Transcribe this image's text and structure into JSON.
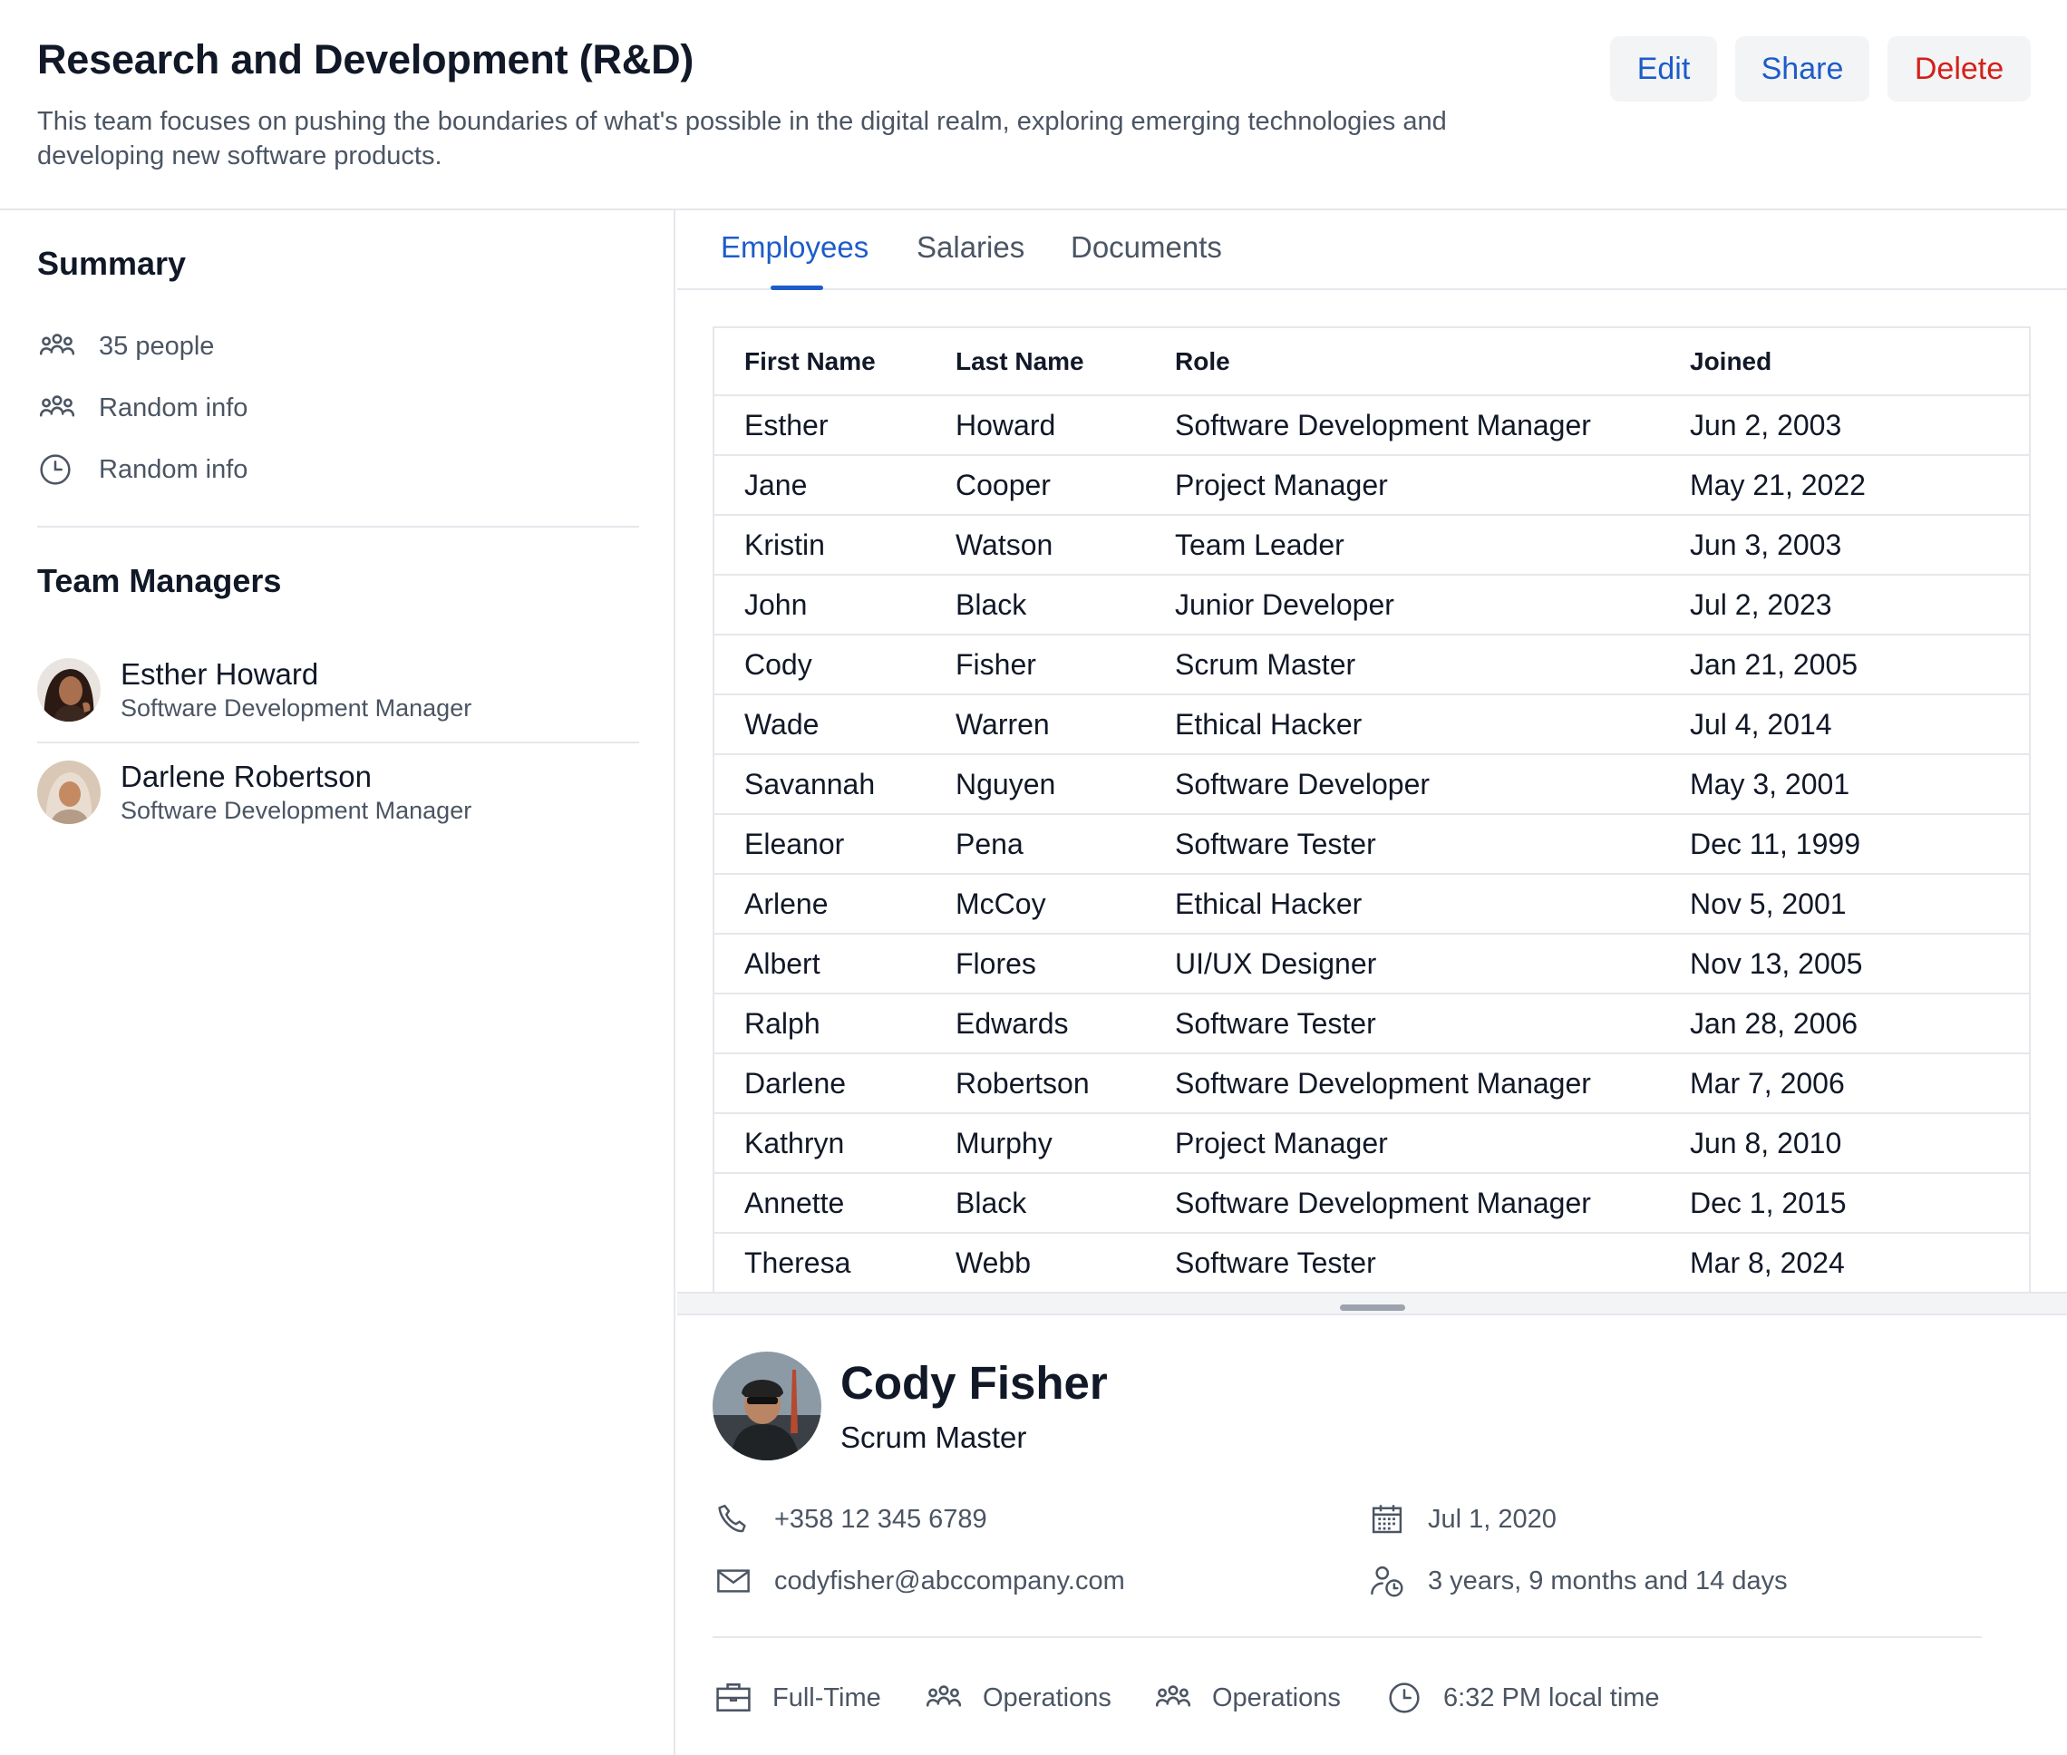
{
  "header": {
    "title": "Research and Development (R&D)",
    "description": "This team focuses on pushing the boundaries of what's possible in the digital realm, exploring emerging technologies and developing new software products.",
    "buttons": {
      "edit": "Edit",
      "share": "Share",
      "delete": "Delete"
    }
  },
  "sidebar": {
    "summary_title": "Summary",
    "summary_items": [
      {
        "icon": "people-group-icon",
        "label": "35 people"
      },
      {
        "icon": "people-group-icon",
        "label": "Random info"
      },
      {
        "icon": "clock-icon",
        "label": "Random info"
      }
    ],
    "managers_title": "Team Managers",
    "managers": [
      {
        "name": "Esther Howard",
        "role": "Software Development Manager"
      },
      {
        "name": "Darlene Robertson",
        "role": "Software Development Manager"
      }
    ]
  },
  "tabs": [
    "Employees",
    "Salaries",
    "Documents"
  ],
  "active_tab": "Employees",
  "table": {
    "headers": [
      "First Name",
      "Last Name",
      "Role",
      "Joined"
    ],
    "rows": [
      [
        "Esther",
        "Howard",
        "Software Development Manager",
        "Jun 2, 2003"
      ],
      [
        "Jane",
        "Cooper",
        "Project Manager",
        "May 21, 2022"
      ],
      [
        "Kristin",
        "Watson",
        "Team Leader",
        "Jun 3, 2003"
      ],
      [
        "John",
        "Black",
        "Junior Developer",
        "Jul 2, 2023"
      ],
      [
        "Cody",
        "Fisher",
        "Scrum Master",
        "Jan 21, 2005"
      ],
      [
        "Wade",
        "Warren",
        "Ethical Hacker",
        "Jul 4, 2014"
      ],
      [
        "Savannah",
        "Nguyen",
        "Software Developer",
        "May 3, 2001"
      ],
      [
        "Eleanor",
        "Pena",
        "Software Tester",
        "Dec 11, 1999"
      ],
      [
        "Arlene",
        "McCoy",
        "Ethical Hacker",
        "Nov 5, 2001"
      ],
      [
        "Albert",
        "Flores",
        "UI/UX Designer",
        "Nov 13, 2005"
      ],
      [
        "Ralph",
        "Edwards",
        "Software Tester",
        "Jan 28, 2006"
      ],
      [
        "Darlene",
        "Robertson",
        "Software Development Manager",
        "Mar 7, 2006"
      ],
      [
        "Kathryn",
        "Murphy",
        "Project Manager",
        "Jun 8, 2010"
      ],
      [
        "Annette",
        "Black",
        "Software Development Manager",
        "Dec 1, 2015"
      ],
      [
        "Theresa",
        "Webb",
        "Software Tester",
        "Mar 8, 2024"
      ]
    ]
  },
  "detail": {
    "name": "Cody Fisher",
    "role": "Scrum Master",
    "phone": "+358 12 345 6789",
    "email": "codyfisher@abccompany.com",
    "start_date": "Jul 1, 2020",
    "tenure": "3 years, 9 months and 14 days",
    "chips": [
      {
        "icon": "briefcase-icon",
        "label": "Full-Time"
      },
      {
        "icon": "people-group-icon",
        "label": "Operations"
      },
      {
        "icon": "people-group-icon",
        "label": "Operations"
      },
      {
        "icon": "clock-icon",
        "label": "6:32 PM local time"
      }
    ]
  },
  "colors": {
    "accent": "#1d5cc9",
    "danger": "#d32019",
    "text": "#111827",
    "muted": "#4b5563",
    "border": "#e5e7eb"
  }
}
